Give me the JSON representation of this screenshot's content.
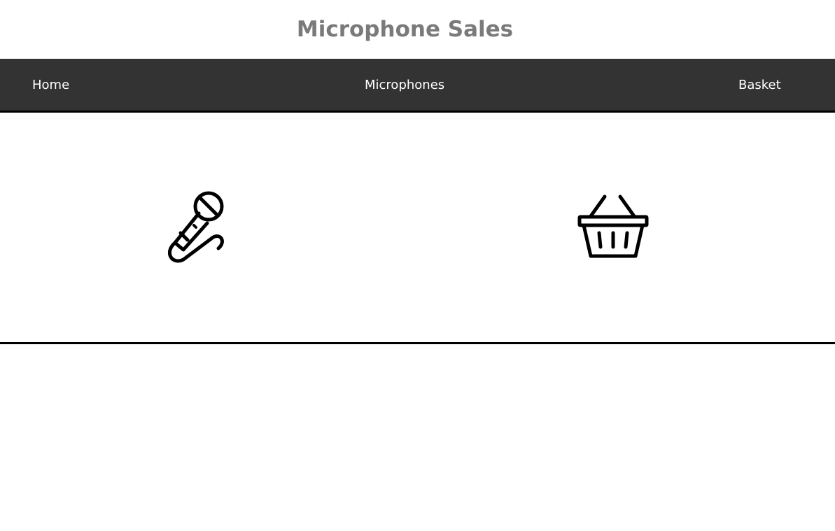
{
  "header": {
    "title": "Microphone Sales"
  },
  "nav": {
    "items": [
      {
        "label": "Home"
      },
      {
        "label": "Microphones"
      },
      {
        "label": "Basket"
      }
    ]
  },
  "features": {
    "microphone": {
      "icon": "microphone-icon"
    },
    "basket": {
      "icon": "basket-icon"
    }
  },
  "colors": {
    "title": "#7a7a7a",
    "navbar": "#333333",
    "nav_text": "#ffffff",
    "divider": "#000000"
  }
}
